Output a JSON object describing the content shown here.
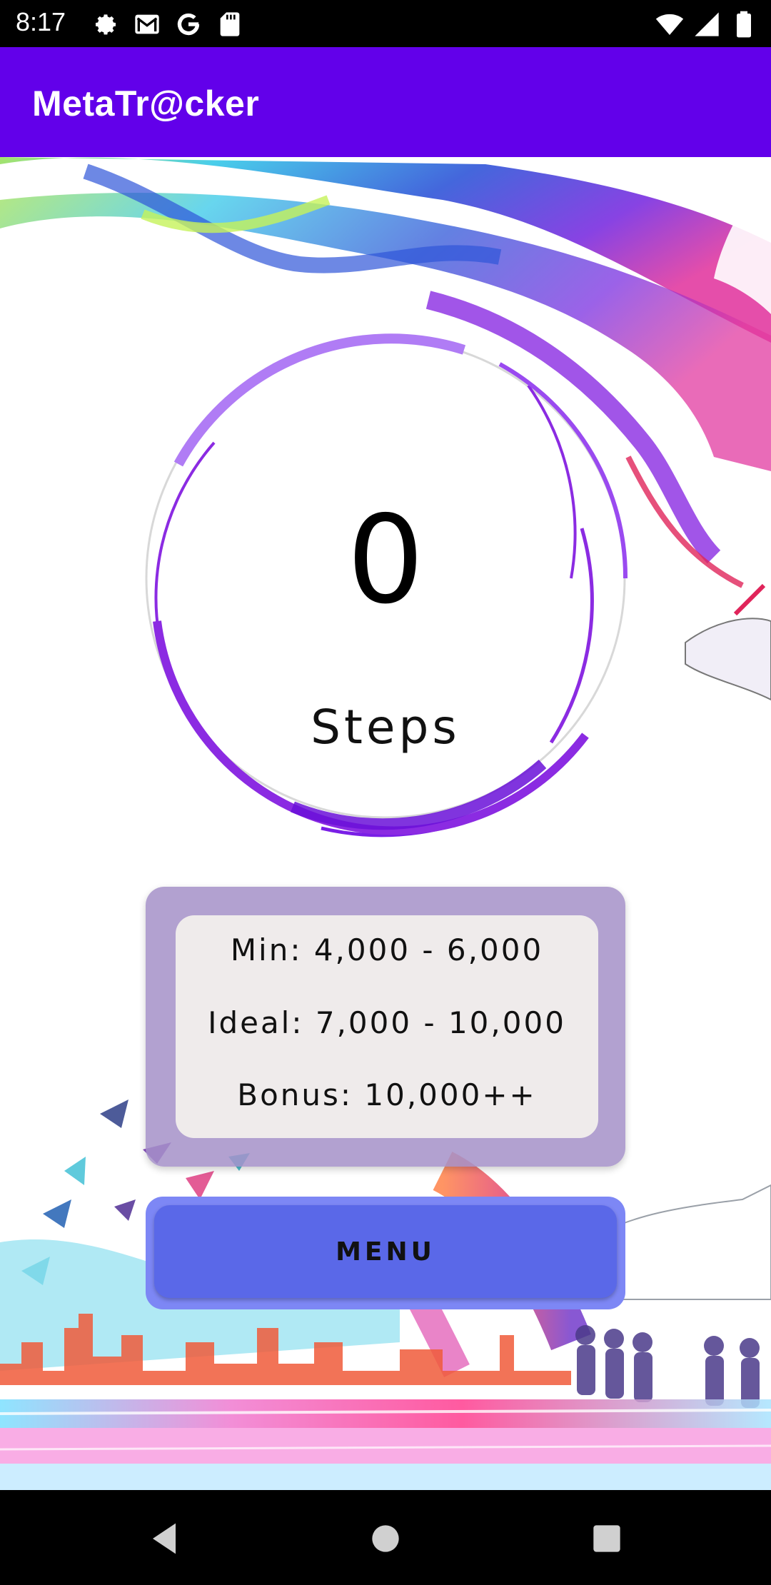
{
  "status_bar": {
    "time": "8:17",
    "left_icons": [
      "settings-gear-icon",
      "gmail-icon",
      "google-icon",
      "sd-card-icon"
    ],
    "right_icons": [
      "wifi-icon",
      "cell-signal-icon",
      "battery-icon"
    ]
  },
  "app_bar": {
    "title": "MetaTr@cker",
    "color": "#6200ea"
  },
  "step_counter": {
    "count": "0",
    "label": "Steps",
    "ring_color": "#8b2be2"
  },
  "goals": {
    "min": "Min: 4,000 - 6,000",
    "ideal": "Ideal: 7,000 - 10,000",
    "bonus": "Bonus: 10,000++"
  },
  "menu_button": {
    "label": "MENU",
    "color": "#5a68e8"
  },
  "nav_bar": {
    "icons": [
      "back-icon",
      "home-icon",
      "recents-icon"
    ]
  }
}
